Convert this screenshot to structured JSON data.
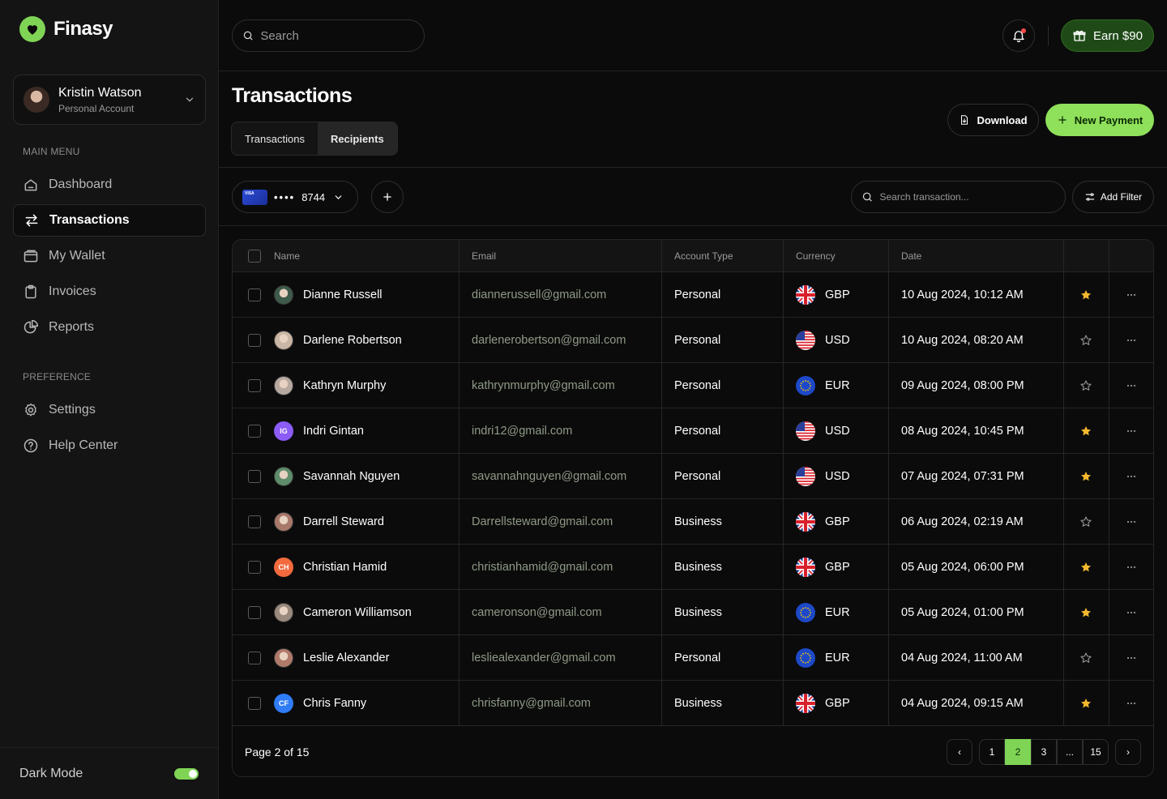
{
  "app": {
    "name": "Finasy"
  },
  "profile": {
    "name": "Kristin Watson",
    "subtitle": "Personal Account"
  },
  "sidebar": {
    "main_caption": "MAIN MENU",
    "main_items": [
      {
        "label": "Dashboard",
        "icon": "home-icon"
      },
      {
        "label": "Transactions",
        "icon": "transfer-icon",
        "active": true
      },
      {
        "label": "My Wallet",
        "icon": "wallet-icon"
      },
      {
        "label": "Invoices",
        "icon": "clipboard-icon"
      },
      {
        "label": "Reports",
        "icon": "pie-chart-icon"
      }
    ],
    "pref_caption": "PREFERENCE",
    "pref_items": [
      {
        "label": "Settings",
        "icon": "gear-icon"
      },
      {
        "label": "Help Center",
        "icon": "help-icon"
      }
    ],
    "dark_mode_label": "Dark Mode",
    "dark_mode_on": true
  },
  "topbar": {
    "search_placeholder": "Search",
    "earn_label": "Earn $90"
  },
  "header": {
    "title": "Transactions",
    "tabs": [
      {
        "label": "Transactions"
      },
      {
        "label": "Recipients",
        "selected": true
      }
    ],
    "download_label": "Download",
    "new_payment_label": "New Payment"
  },
  "filters": {
    "card_brand": "VISA",
    "card_mask": "••••",
    "card_last4": "8744",
    "search_placeholder": "Search transaction...",
    "add_filter_label": "Add Filter"
  },
  "table": {
    "columns": [
      "Name",
      "Email",
      "Account Type",
      "Currency",
      "Date"
    ],
    "rows": [
      {
        "name": "Dianne Russell",
        "avatar": "photo",
        "avatar_color": "#3d5a4a",
        "email": "diannerussell@gmail.com",
        "account_type": "Personal",
        "currency": "GBP",
        "date": "10 Aug 2024, 10:12 AM",
        "starred": true
      },
      {
        "name": "Darlene Robertson",
        "avatar": "photo",
        "avatar_color": "#c9b6a4",
        "email": "darlenerobertson@gmail.com",
        "account_type": "Personal",
        "currency": "USD",
        "date": "10 Aug 2024, 08:20 AM",
        "starred": false
      },
      {
        "name": "Kathryn Murphy",
        "avatar": "photo",
        "avatar_color": "#b8a9a0",
        "email": "kathrynmurphy@gmail.com",
        "account_type": "Personal",
        "currency": "EUR",
        "date": "09 Aug 2024, 08:00 PM",
        "starred": false
      },
      {
        "name": "Indri Gintan",
        "initials": "IG",
        "avatar_color": "#8b5cf6",
        "email": "indri12@gmail.com",
        "account_type": "Personal",
        "currency": "USD",
        "date": "08 Aug 2024, 10:45 PM",
        "starred": true
      },
      {
        "name": "Savannah Nguyen",
        "avatar": "photo",
        "avatar_color": "#5f8c6a",
        "email": "savannahnguyen@gmail.com",
        "account_type": "Personal",
        "currency": "USD",
        "date": "07 Aug 2024, 07:31 PM",
        "starred": true
      },
      {
        "name": "Darrell Steward",
        "avatar": "photo",
        "avatar_color": "#a8786a",
        "email": "Darrellsteward@gmail.com",
        "account_type": "Business",
        "currency": "GBP",
        "date": "06 Aug 2024, 02:19 AM",
        "starred": false
      },
      {
        "name": "Christian Hamid",
        "initials": "CH",
        "avatar_color": "#f26a3d",
        "email": "christianhamid@gmail.com",
        "account_type": "Business",
        "currency": "GBP",
        "date": "05 Aug 2024, 06:00 PM",
        "starred": true
      },
      {
        "name": "Cameron Williamson",
        "avatar": "photo",
        "avatar_color": "#9a8a7e",
        "email": "cameronson@gmail.com",
        "account_type": "Business",
        "currency": "EUR",
        "date": "05 Aug 2024, 01:00 PM",
        "starred": true
      },
      {
        "name": "Leslie Alexander",
        "avatar": "photo",
        "avatar_color": "#b07a6a",
        "email": "lesliealexander@gmail.com",
        "account_type": "Personal",
        "currency": "EUR",
        "date": "04 Aug 2024, 11:00 AM",
        "starred": false
      },
      {
        "name": "Chris Fanny",
        "initials": "CF",
        "avatar_color": "#2f7cf6",
        "email": "chrisfanny@gmail.com",
        "account_type": "Business",
        "currency": "GBP",
        "date": "04 Aug 2024, 09:15 AM",
        "starred": true
      }
    ]
  },
  "pagination": {
    "label": "Page 2 of 15",
    "pages": [
      "1",
      "2",
      "3",
      "...",
      "15"
    ],
    "current": "2",
    "prev_glyph": "‹",
    "next_glyph": "›"
  },
  "colors": {
    "accent": "#7fd455",
    "star": "#f5b82e",
    "email_text": "#8f9a86"
  }
}
